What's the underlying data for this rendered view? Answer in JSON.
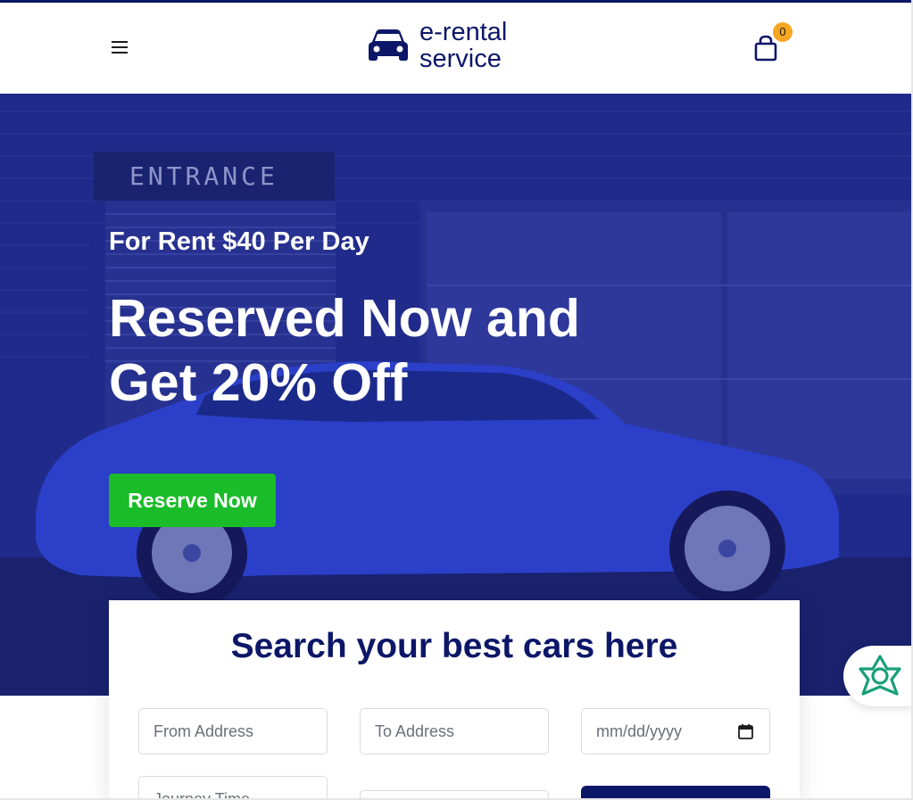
{
  "header": {
    "menu_icon": "hamburger-icon",
    "logo_icon": "car-icon",
    "logo_line1": "e-rental",
    "logo_line2": "service",
    "cart_icon": "shopping-bag-icon",
    "cart_count": "0"
  },
  "hero": {
    "subtitle": "For Rent $40 Per Day",
    "title_line1": "Reserved Now and",
    "title_line2": "Get 20% Off",
    "reserve_label": "Reserve Now"
  },
  "search": {
    "title": "Search your best cars here",
    "from_placeholder": "From Address",
    "to_placeholder": "To Address",
    "date_placeholder": "mm/dd/yyyy",
    "date_icon": "calendar-icon",
    "time_placeholder": "Journey Time"
  },
  "widget": {
    "icon": "ai-assistant-icon"
  },
  "colors": {
    "brand": "#0c1768",
    "accent_green": "#1abc2a",
    "badge": "#f6a623",
    "hero_overlay": "#1f2a8c"
  }
}
